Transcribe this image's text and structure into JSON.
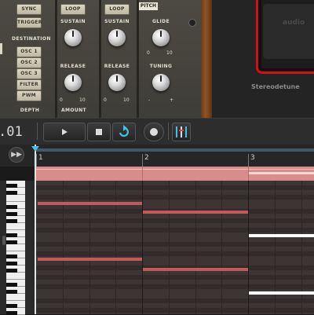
{
  "synth": {
    "col1": {
      "sync": "SYNC",
      "trigger": "TRIGGER",
      "destination": "DESTINATION",
      "osc1": "OSC 1",
      "osc2": "OSC 2",
      "osc3": "OSC 3",
      "filter": "FILTER",
      "pwm": "PWM",
      "depth": "DEPTH"
    },
    "col2": {
      "loop": "LOOP",
      "sustain": "SUSTAIN",
      "release": "RELEASE",
      "amount": "AMOUNT",
      "min": "0",
      "max": "10"
    },
    "col3": {
      "loop": "LOOP",
      "sustain": "SUSTAIN",
      "release": "RELEASE",
      "min": "0",
      "max": "10"
    },
    "col4": {
      "pitch": "PITCH",
      "glide": "GLIDE",
      "tuning": "TUNING",
      "min": "0",
      "max": "10",
      "minus": "-",
      "plus": "+"
    },
    "brand": "audio",
    "device": "Stereodetune"
  },
  "transport": {
    "time": ".01"
  },
  "ruler": {
    "bars": [
      "1",
      "2",
      "3"
    ]
  },
  "colors": {
    "note": "#c35a59",
    "note_selected": "#ffffff",
    "accent": "#3ec3e8",
    "region": "#d88c8c"
  }
}
